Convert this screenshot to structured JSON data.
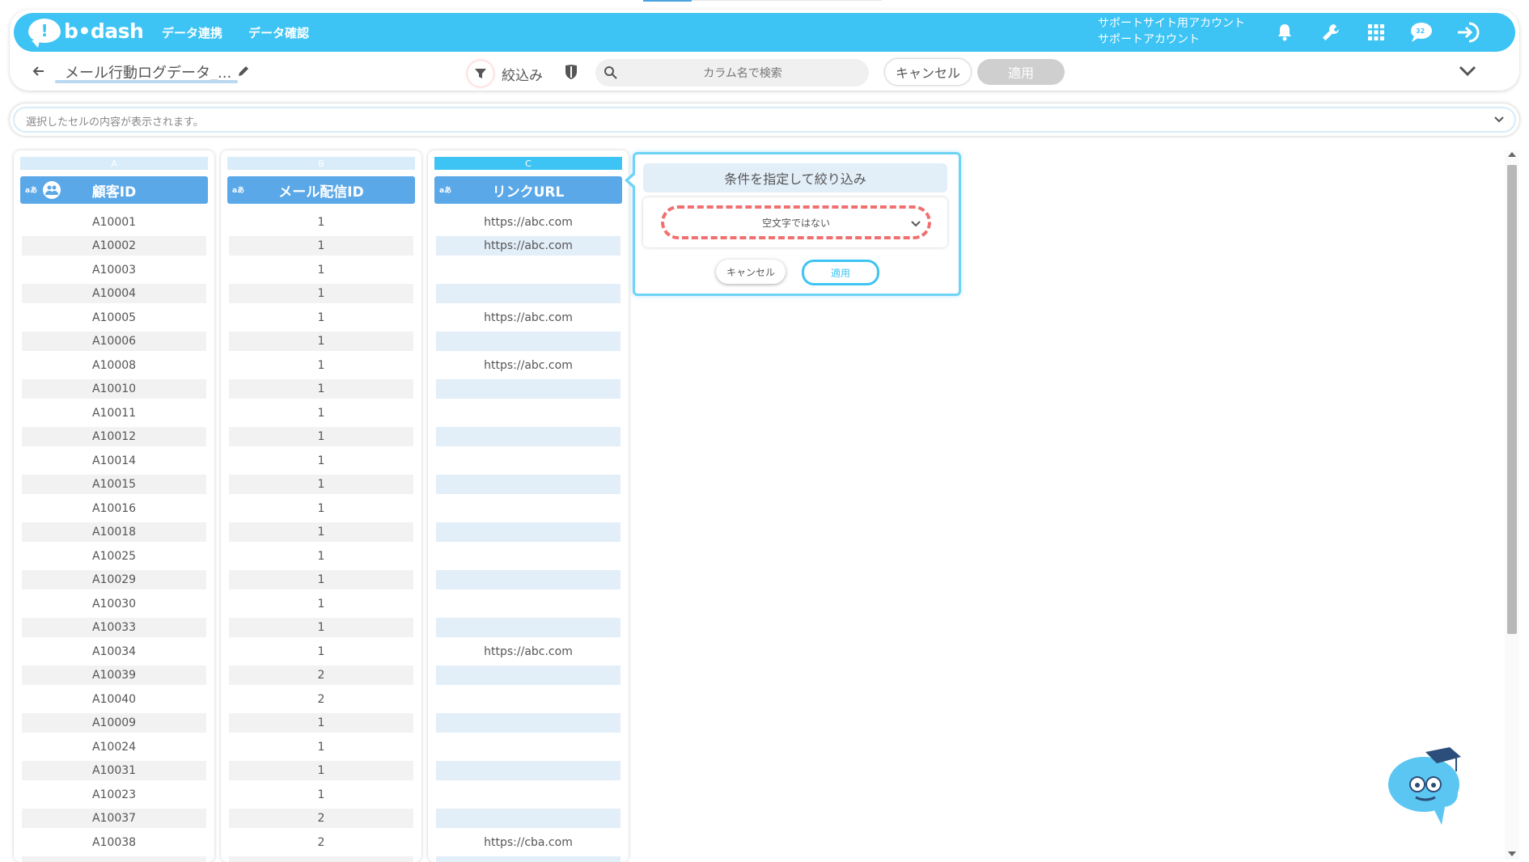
{
  "header": {
    "logo_text": "b•dash",
    "logo_mark": "!",
    "nav": [
      "データ連携",
      "データ確認"
    ],
    "account_line1": "サポートサイト用アカウント",
    "account_line2": "サポートアカウント",
    "notification_count": "32",
    "brand_color": "#3ec4f4"
  },
  "toolbar": {
    "sheet_name": "メール行動ログデータ_...",
    "filter_label": "絞込み",
    "search_placeholder": "カラム名で検索",
    "cancel_label": "キャンセル",
    "apply_label": "適用"
  },
  "cell_display": {
    "placeholder": "選択したセルの内容が表示されます。"
  },
  "columns": [
    {
      "letter": "A",
      "type": "aあ",
      "name": "顧客ID"
    },
    {
      "letter": "B",
      "type": "aあ",
      "name": "メール配信ID"
    },
    {
      "letter": "C",
      "type": "aあ",
      "name": "リンクURL"
    }
  ],
  "rows": [
    [
      "A10001",
      "1",
      "https://abc.com"
    ],
    [
      "A10002",
      "1",
      "https://abc.com"
    ],
    [
      "A10003",
      "1",
      ""
    ],
    [
      "A10004",
      "1",
      ""
    ],
    [
      "A10005",
      "1",
      "https://abc.com"
    ],
    [
      "A10006",
      "1",
      ""
    ],
    [
      "A10008",
      "1",
      "https://abc.com"
    ],
    [
      "A10010",
      "1",
      ""
    ],
    [
      "A10011",
      "1",
      ""
    ],
    [
      "A10012",
      "1",
      ""
    ],
    [
      "A10014",
      "1",
      ""
    ],
    [
      "A10015",
      "1",
      ""
    ],
    [
      "A10016",
      "1",
      ""
    ],
    [
      "A10018",
      "1",
      ""
    ],
    [
      "A10025",
      "1",
      ""
    ],
    [
      "A10029",
      "1",
      ""
    ],
    [
      "A10030",
      "1",
      ""
    ],
    [
      "A10033",
      "1",
      ""
    ],
    [
      "A10034",
      "1",
      "https://abc.com"
    ],
    [
      "A10039",
      "2",
      ""
    ],
    [
      "A10040",
      "2",
      ""
    ],
    [
      "A10009",
      "1",
      ""
    ],
    [
      "A10024",
      "1",
      ""
    ],
    [
      "A10031",
      "1",
      ""
    ],
    [
      "A10023",
      "1",
      ""
    ],
    [
      "A10037",
      "2",
      ""
    ],
    [
      "A10038",
      "2",
      "https://cba.com"
    ]
  ],
  "filter_popup": {
    "title": "条件を指定して絞り込み",
    "condition": "空文字ではない",
    "cancel_label": "キャンセル",
    "apply_label": "適用"
  }
}
